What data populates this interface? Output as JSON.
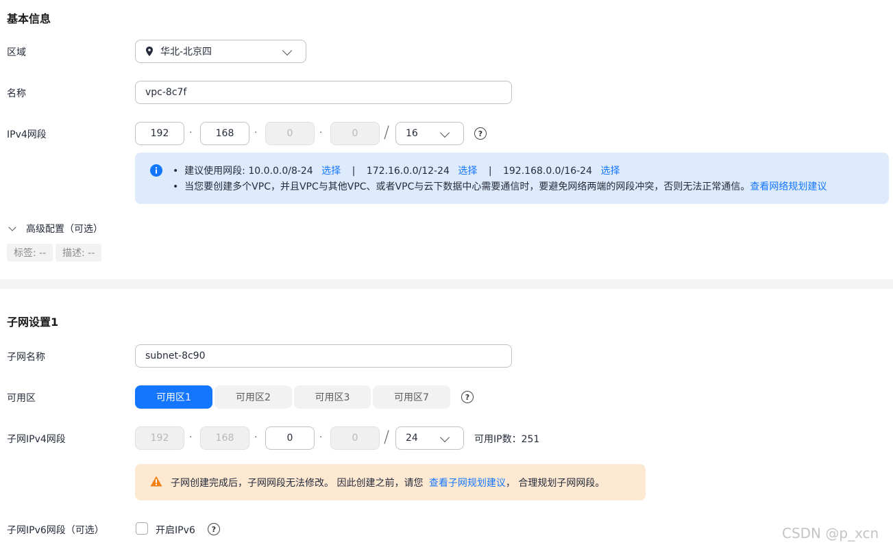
{
  "basic": {
    "title": "基本信息",
    "region_label": "区域",
    "region_value": "华北-北京四",
    "name_label": "名称",
    "name_value": "vpc-8c7f",
    "ipv4_label": "IPv4网段",
    "ip": [
      "192",
      "168",
      "0",
      "0"
    ],
    "mask": "16",
    "dot": "·",
    "slash": "/",
    "help": "?",
    "info": {
      "line1_prefix": "建议使用网段: 10.0.0.0/8-24",
      "select1": "选择",
      "range2": "172.16.0.0/12-24",
      "select2": "选择",
      "range3": "192.168.0.0/16-24",
      "select3": "选择",
      "divider": "|",
      "line2_text": "当您要创建多个VPC，并且VPC与其他VPC、或者VPC与云下数据中心需要通信时，要避免网络两端的网段冲突，否则无法正常通信。",
      "line2_link": "查看网络规划建议"
    },
    "advanced_label": "高级配置（可选）",
    "tags": [
      "标签: --",
      "描述: --"
    ]
  },
  "subnet": {
    "title": "子网设置1",
    "name_label": "子网名称",
    "name_value": "subnet-8c90",
    "az_label": "可用区",
    "az_options": [
      "可用区1",
      "可用区2",
      "可用区3",
      "可用区7"
    ],
    "az_selected": "可用区1",
    "ipv4_label": "子网IPv4网段",
    "ip": [
      "192",
      "168",
      "0",
      "0"
    ],
    "mask": "24",
    "available_ip": "可用IP数：251",
    "warn": {
      "text1": "子网创建完成后，子网网段无法修改。 因此创建之前，请您",
      "link": "查看子网规划建议",
      "text2": "， 合理规划子网网段。"
    },
    "ipv6_label": "子网IPv6网段（可选）",
    "ipv6_checkbox_label": "开启IPv6"
  },
  "watermark": "CSDN @p_xcn",
  "colors": {
    "primary": "#1476ff",
    "info_bg": "#deebfd",
    "warn_bg": "#fde9d2",
    "warn_icon": "#f57f17"
  }
}
